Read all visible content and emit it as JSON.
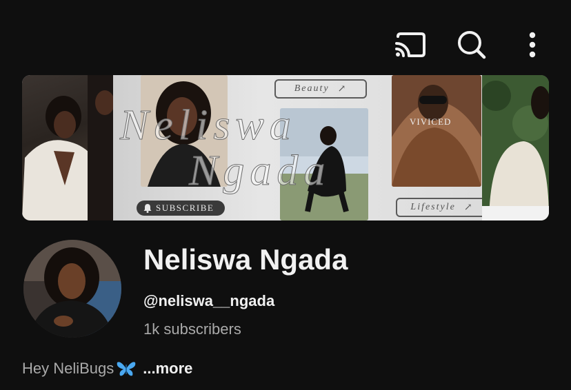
{
  "toolbar": {
    "icons": [
      "cast-icon",
      "search-icon",
      "more-vertical-icon"
    ]
  },
  "banner": {
    "pill_beauty": "Beauty",
    "pill_lifestyle": "Lifestyle",
    "subscribe_label": "SUBSCRIBE",
    "script_line1": "Neliswa",
    "script_line2": "Ngada",
    "magazine_text": "VIVICED"
  },
  "channel": {
    "name": "Neliswa Ngada",
    "handle": "@neliswa__ngada",
    "subscribers": "1k subscribers",
    "description": "Hey NeliBugs",
    "description_emoji": "butterfly-icon",
    "more_label": "...more"
  },
  "colors": {
    "background": "#0f0f0f",
    "primary_text": "#f1f1f1",
    "secondary_text": "#aaaaaa",
    "butterfly": "#4aa8f0"
  }
}
